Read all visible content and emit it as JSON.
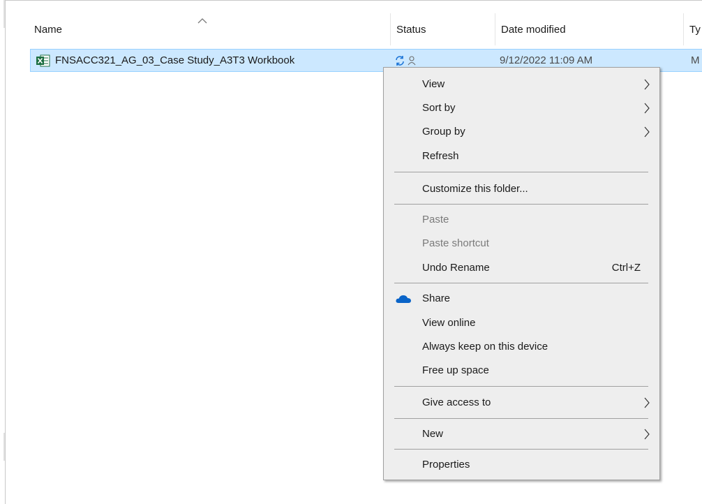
{
  "columns": {
    "name": "Name",
    "status": "Status",
    "date_modified": "Date modified",
    "type": "Ty"
  },
  "file": {
    "name": "FNSACC321_AG_03_Case Study_A3T3 Workbook",
    "date": "9/12/2022 11:09 AM",
    "type": "M",
    "icon": "excel-file-icon",
    "status_icons": [
      "sync-icon",
      "shared-person-icon"
    ]
  },
  "menu": {
    "view": "View",
    "sort_by": "Sort by",
    "group_by": "Group by",
    "refresh": "Refresh",
    "customize": "Customize this folder...",
    "paste": "Paste",
    "paste_shortcut": "Paste shortcut",
    "undo_rename": "Undo Rename",
    "undo_shortcut": "Ctrl+Z",
    "share": "Share",
    "view_online": "View online",
    "always_keep": "Always keep on this device",
    "free_up": "Free up space",
    "give_access": "Give access to",
    "new": "New",
    "properties": "Properties"
  },
  "colors": {
    "selection_bg": "#cce8ff",
    "selection_border": "#99d1ff",
    "menu_bg": "#eeeeee",
    "onedrive_blue": "#0a64c8",
    "sync_blue": "#1a73d6",
    "excel_green": "#1d6f42"
  }
}
